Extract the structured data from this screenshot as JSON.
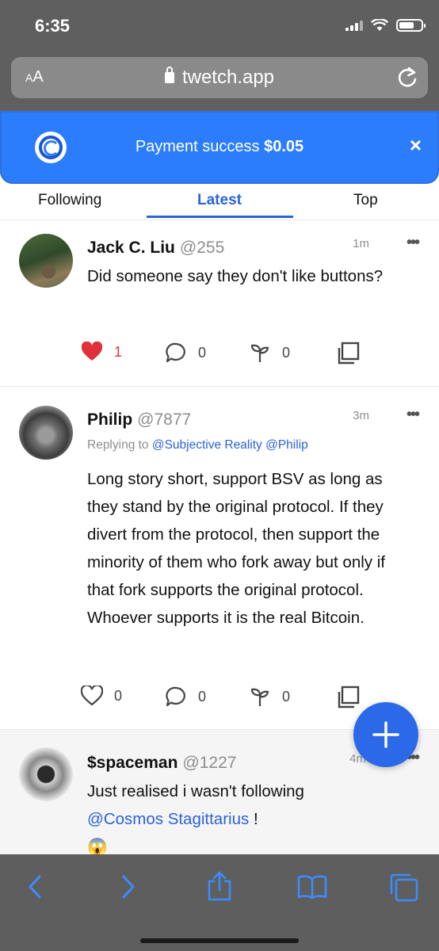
{
  "status_bar": {
    "time": "6:35"
  },
  "browser": {
    "text_size_label": "AA",
    "url": "twetch.app"
  },
  "banner": {
    "message": "Payment success",
    "amount": "$0.05",
    "close_label": "×"
  },
  "tabs": [
    {
      "label": "Following"
    },
    {
      "label": "Latest",
      "active": true
    },
    {
      "label": "Top"
    }
  ],
  "posts": [
    {
      "name": "Jack C. Liu",
      "handle": "@255",
      "time": "1m",
      "more": "•••",
      "text": "Did someone say they don't like buttons?",
      "likes": "1",
      "liked": true,
      "comments": "0",
      "branches": "0"
    },
    {
      "name": "Philip",
      "handle": "@7877",
      "time": "3m",
      "more": "•••",
      "reply_prefix": "Replying to",
      "reply_mention_1": "@Subjective Reality",
      "reply_mention_2": "@Philip",
      "text": "Long story short, support BSV as long as they stand by the original protocol. If they divert from the protocol, then support the minority of them who fork away but only if that fork supports the original protocol. Whoever supports it is the real Bitcoin.",
      "likes": "0",
      "liked": false,
      "comments": "0",
      "branches": "0"
    },
    {
      "name": "$spaceman",
      "handle": "@1227",
      "time": "4m",
      "more": "•••",
      "text_prefix": "Just realised i wasn't following",
      "mention": "@Cosmos Stagittarius",
      "text_suffix": " !",
      "emoji": "😱"
    }
  ],
  "colors": {
    "accent": "#2c63d8",
    "banner": "#2b7dfb",
    "like": "#e0303a",
    "chrome": "#5f5f5f"
  },
  "icons": [
    "lock-icon",
    "reload-icon",
    "twetch-logo-icon",
    "close-icon",
    "heart-icon",
    "comment-icon",
    "branch-icon",
    "copy-icon",
    "more-icon",
    "plus-icon",
    "back-icon",
    "forward-icon",
    "share-icon",
    "bookmarks-icon",
    "tabs-icon"
  ]
}
